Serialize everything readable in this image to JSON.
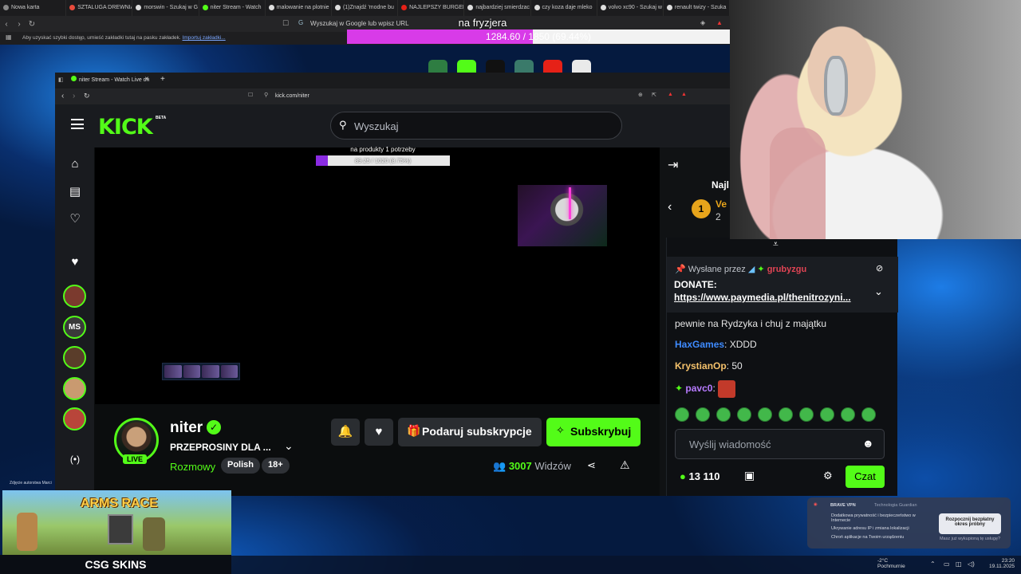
{
  "outer_browser": {
    "tabs": [
      {
        "label": "Nowa karta",
        "color": "#888888"
      },
      {
        "label": "SZTALUGA DREWNIA",
        "color": "#e94b3c"
      },
      {
        "label": "morswin - Szukaj w G",
        "color": "#dddddd"
      },
      {
        "label": "niter Stream - Watch",
        "color": "#53fc18"
      },
      {
        "label": "malowanie na plotnie",
        "color": "#dddddd"
      },
      {
        "label": "(1)Znajdź 'modne bu",
        "color": "#dddddd"
      },
      {
        "label": "NAJLEPSZY BURGER",
        "color": "#e62117"
      },
      {
        "label": "najbardziej smierdzac",
        "color": "#dddddd"
      },
      {
        "label": "czy koza daje mleko",
        "color": "#dddddd"
      },
      {
        "label": "volvo xc90 - Szukaj w",
        "color": "#dddddd"
      },
      {
        "label": "renault twizy - Szuka",
        "color": "#dddddd"
      }
    ],
    "address_placeholder": "Wyszukaj w Google lub wpisz URL",
    "bookmarks_text": "Aby uzyskać szybki dostęp, umieść zakładki tutaj na pasku zakładek.",
    "bookmarks_link": "Importuj zakładki..."
  },
  "goal": {
    "title": "na fryzjera",
    "progress_text": "1284.60 / 1850 (69.44%)",
    "fraction": 0.6944
  },
  "inner_browser": {
    "tab_label": "niter Stream - Watch Live on",
    "url": "kick.com/niter"
  },
  "kick": {
    "logo": "KICK",
    "beta": "BETA",
    "search_placeholder": "Wyszukaj",
    "video_goal_title": "na produkty 1 potrzeby",
    "video_goal_text": "89.25 / 1020 (8.75%)",
    "video_goal_fraction": 0.0875,
    "following_initials": "MS",
    "streamer": {
      "name": "niter",
      "live_label": "LIVE",
      "title": "PRZEPROSINY DLA ...",
      "category": "Rozmowy",
      "tags": [
        "Polish",
        "18+"
      ],
      "viewers_count": "3007",
      "viewers_label": "Widzów"
    },
    "buttons": {
      "gift": "Podaruj subskrypcje",
      "subscribe": "Subskrybuj"
    },
    "chat_panel": {
      "heading": "Najl",
      "rank": "1",
      "user_fragment": "Ve",
      "sub_fragment": "2"
    }
  },
  "chat": {
    "pinned_by": "Wysłane przez",
    "pinned_user": "grubyzgu",
    "pinned_label": "DONATE:",
    "pinned_link": "https://www.paymedia.pl/thenitrozyni...",
    "messages": [
      {
        "user": "",
        "text": "pewnie na Rydzyka i chuj z majątku",
        "color": "#e6e6e6"
      },
      {
        "user": "HaxGames",
        "text": ": XDDD",
        "color": "#3e8bff"
      },
      {
        "user": "KrystianOp",
        "text": ": 50",
        "color": "#f5c26b"
      },
      {
        "user": "pavc0",
        "text": ":",
        "color": "#b77bff"
      }
    ],
    "input_placeholder": "Wyślij wiadomość",
    "points": "13 110",
    "send_label": "Czat"
  },
  "ad": {
    "title": "ARMS RACE",
    "brand": "CSG SKINS"
  },
  "vpn": {
    "title": "BRAVE VPN",
    "subtitle": "Technologia Guardian",
    "items": [
      "Dodatkowa prywatność i bezpieczeństwo w Internecie",
      "Ukrywanie adresu IP i zmiana lokalizacji",
      "Chroń aplikacje na Twoim urządzeniu"
    ],
    "cta": "Rozpocznij bezpłatny okres próbny",
    "footer": "Masz już wykupioną tę usługę?"
  },
  "taskbar": {
    "weather_temp": "-2°C",
    "weather_desc": "Pochmurnie",
    "time": "23:20",
    "date": "19.11.2025"
  },
  "desktop_credit": "Zdjęcie autorstwa Marci"
}
